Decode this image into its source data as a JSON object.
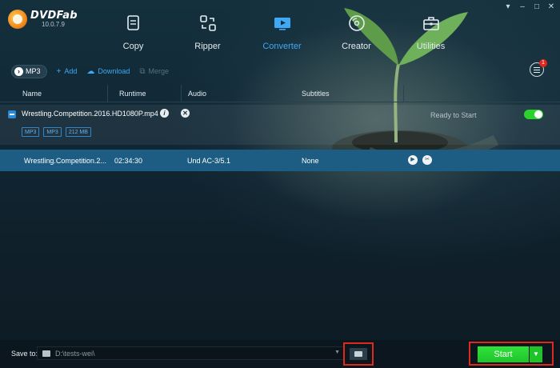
{
  "app": {
    "logo_name": "DVDFab",
    "version": "10.0.7.9"
  },
  "nav": [
    {
      "label": "Copy",
      "icon": "copy-icon"
    },
    {
      "label": "Ripper",
      "icon": "ripper-icon"
    },
    {
      "label": "Converter",
      "icon": "converter-icon",
      "active": true
    },
    {
      "label": "Creator",
      "icon": "creator-disc-icon"
    },
    {
      "label": "Utilities",
      "icon": "toolbox-icon"
    }
  ],
  "toolbar": {
    "profile_label": "MP3",
    "add_label": "Add",
    "download_label": "Download",
    "merge_label": "Merge",
    "notification_count": "1"
  },
  "table": {
    "headers": [
      "Name",
      "Runtime",
      "Audio",
      "Subtitles"
    ]
  },
  "file": {
    "name": "Wrestling.Competition.2016.HD1080P.mp4",
    "tags": [
      "MP3",
      "MP3",
      "212 MB"
    ],
    "status": "Ready to Start",
    "enabled": true
  },
  "title_row": {
    "name": "Wrestling.Competition.2...",
    "runtime": "02:34:30",
    "audio": "Und AC-3/5.1",
    "subtitles": "None"
  },
  "bottom": {
    "save_label": "Save to:",
    "path": "D:\\tests-wei\\",
    "start_label": "Start"
  },
  "colors": {
    "accent": "#3fa9f5",
    "start_green": "#22cc2e",
    "highlight_red": "#e0281c",
    "selected_row": "#1d5d83"
  }
}
